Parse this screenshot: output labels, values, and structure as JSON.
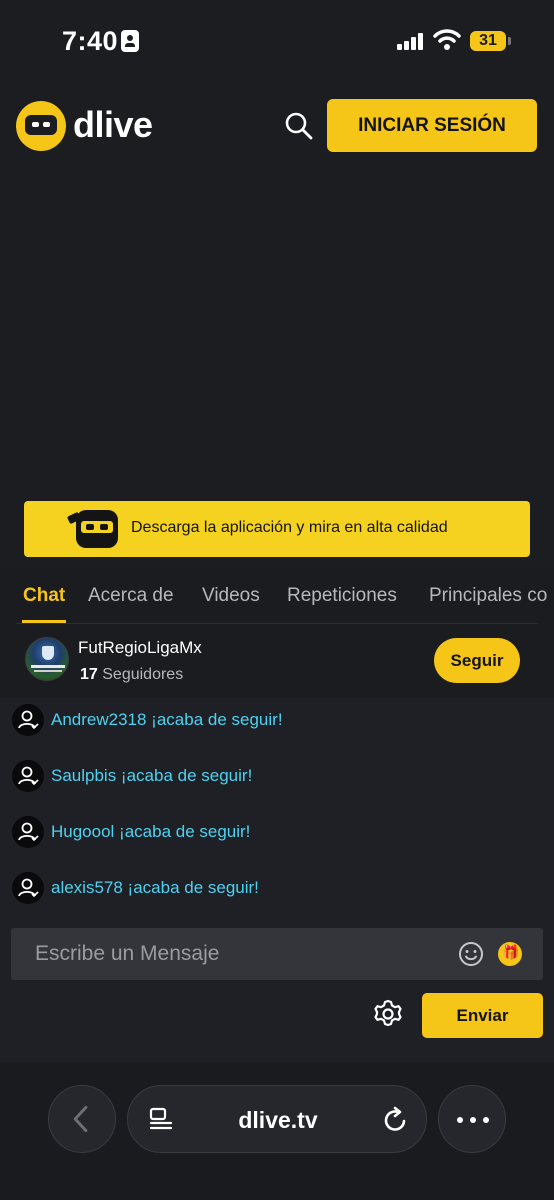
{
  "status_bar": {
    "time": "7:40",
    "battery": "31"
  },
  "header": {
    "logo_text": "dlive",
    "login_label": "INICIAR SESIÓN"
  },
  "banner": {
    "text": "Descarga la aplicación y mira en alta calidad"
  },
  "tabs": [
    {
      "label": "Chat",
      "active": true
    },
    {
      "label": "Acerca de"
    },
    {
      "label": "Videos"
    },
    {
      "label": "Repeticiones"
    },
    {
      "label": "Principales co"
    }
  ],
  "channel": {
    "name": "FutRegioLigaMx",
    "followers_count": "17",
    "followers_label": "Seguidores",
    "follow_label": "Seguir"
  },
  "chat": {
    "messages": [
      {
        "text": "Andrew2318 ¡acaba de seguir!"
      },
      {
        "text": "Saulpbis ¡acaba de seguir!"
      },
      {
        "text": "Hugoool ¡acaba de seguir!"
      },
      {
        "text": "alexis578 ¡acaba de seguir!"
      }
    ],
    "input_placeholder": "Escribe un Mensaje",
    "send_label": "Enviar"
  },
  "browser": {
    "url": "dlive.tv"
  },
  "colors": {
    "accent": "#f5c518",
    "chat_name": "#4fd1f0",
    "background": "#1b1c20"
  }
}
